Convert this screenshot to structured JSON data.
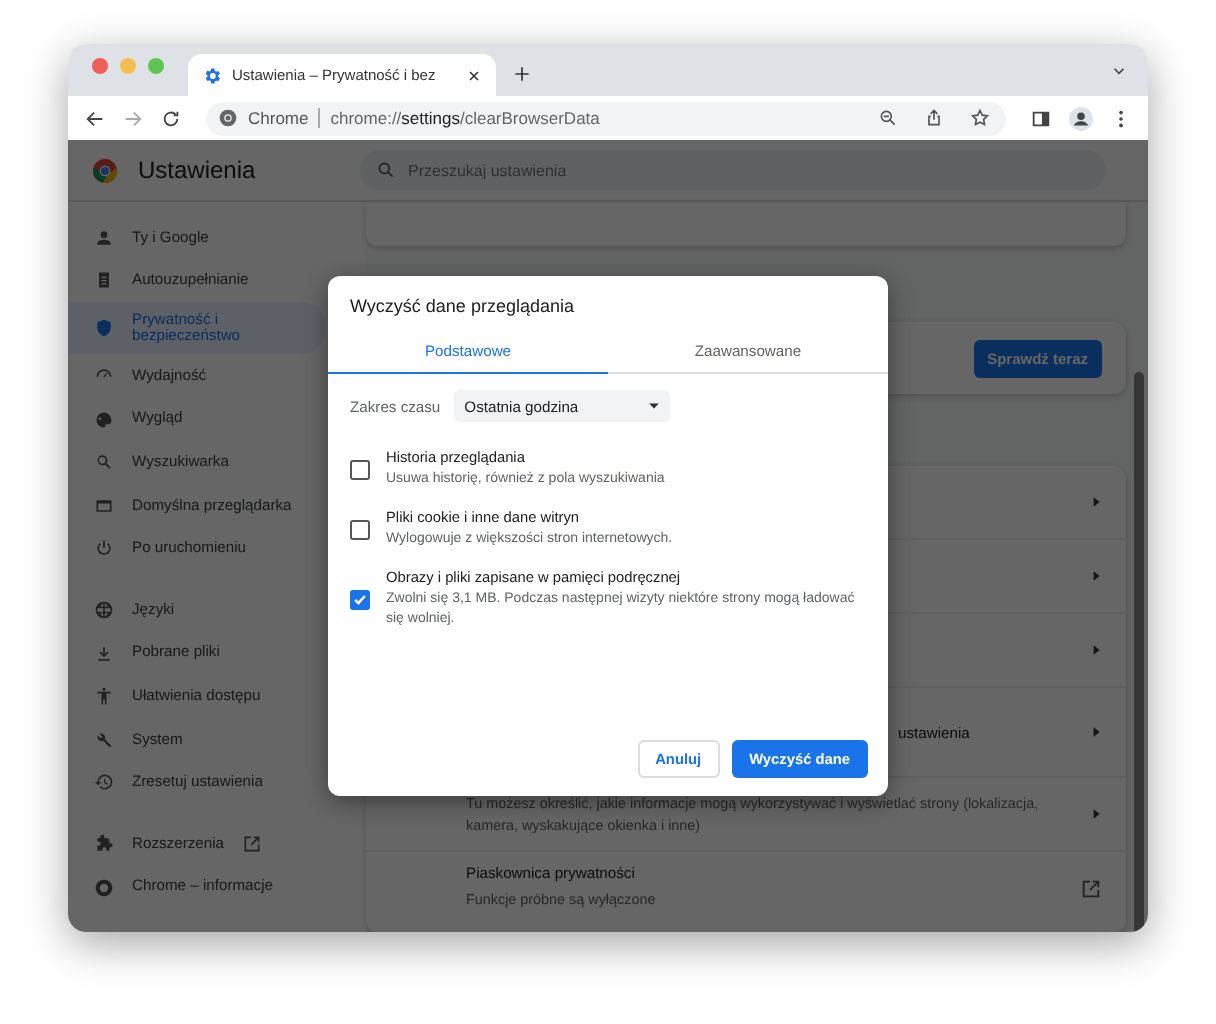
{
  "window": {
    "tab_title": "Ustawienia – Prywatność i bez"
  },
  "address_bar": {
    "site_label": "Chrome",
    "url": "chrome://**settings**/clearBrowserData"
  },
  "settings": {
    "title": "Ustawienia",
    "search_placeholder": "Przeszukaj ustawienia"
  },
  "sidebar": {
    "groups": [
      [
        {
          "label": "Ty i Google",
          "selected": false,
          "external": false
        },
        {
          "label": "Autouzupełnianie",
          "selected": false,
          "external": false
        },
        {
          "label": "Prywatność i bezpieczeństwo",
          "selected": true,
          "external": false
        },
        {
          "label": "Wydajność",
          "selected": false,
          "external": false
        },
        {
          "label": "Wygląd",
          "selected": false,
          "external": false
        },
        {
          "label": "Wyszukiwarka",
          "selected": false,
          "external": false
        },
        {
          "label": "Domyślna przeglądarka",
          "selected": false,
          "external": false
        },
        {
          "label": "Po uruchomieniu",
          "selected": false,
          "external": false
        }
      ],
      [
        {
          "label": "Języki",
          "selected": false,
          "external": false
        },
        {
          "label": "Pobrane pliki",
          "selected": false,
          "external": false
        },
        {
          "label": "Ułatwienia dostępu",
          "selected": false,
          "external": false
        },
        {
          "label": "System",
          "selected": false,
          "external": false
        },
        {
          "label": "Zresetuj ustawienia",
          "selected": false,
          "external": false
        }
      ],
      [
        {
          "label": "Rozszerzenia",
          "selected": false,
          "external": true
        },
        {
          "label": "Chrome – informacje",
          "selected": false,
          "external": false
        }
      ]
    ]
  },
  "safety_card": {
    "button": "Sprawdź teraz"
  },
  "privacy_card": {
    "rows": [
      {
        "title": "",
        "description": ""
      },
      {
        "title": "",
        "description": ""
      },
      {
        "title": "",
        "description": ""
      },
      {
        "title": "ustawienia",
        "description": ""
      },
      {
        "title": "",
        "description": "Tu możesz określić, jakie informacje mogą wykorzystywać i wyświetlać strony (lokalizacja, kamera, wyskakujące okienka i inne)"
      },
      {
        "title": "Piaskownica prywatności",
        "description": "Funkcje próbne są wyłączone",
        "external": true
      }
    ]
  },
  "dialog": {
    "title": "Wyczyść dane przeglądania",
    "tabs": [
      {
        "label": "Podstawowe",
        "selected": true
      },
      {
        "label": "Zaawansowane",
        "selected": false
      }
    ],
    "time_range": {
      "label": "Zakres czasu",
      "value": "Ostatnia godzina"
    },
    "options": [
      {
        "title": "Historia przeglądania",
        "description": "Usuwa historię, również z pola wyszukiwania",
        "checked": false
      },
      {
        "title": "Pliki cookie i inne dane witryn",
        "description": "Wylogowuje z większości stron internetowych.",
        "checked": false
      },
      {
        "title": "Obrazy i pliki zapisane w pamięci podręcznej",
        "description": "Zwolni się 3,1 MB. Podczas następnej wizyty niektóre strony mogą ładować się wolniej.",
        "checked": true
      }
    ],
    "cancel_button": "Anuluj",
    "confirm_button": "Wyczyść dane"
  }
}
